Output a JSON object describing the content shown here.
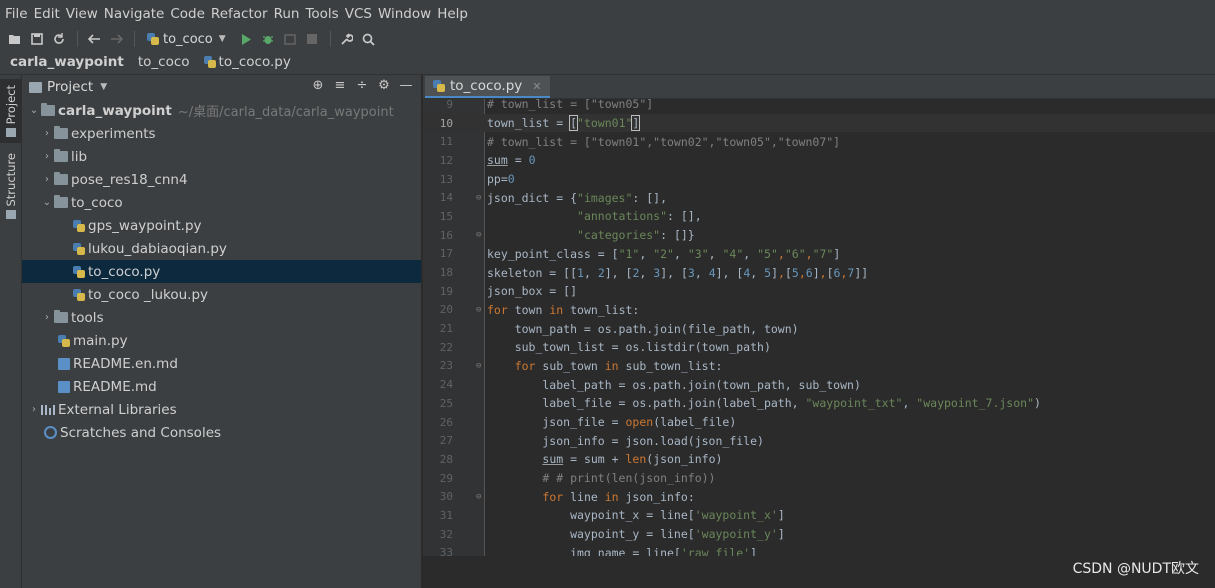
{
  "menu": [
    "File",
    "Edit",
    "View",
    "Navigate",
    "Code",
    "Refactor",
    "Run",
    "Tools",
    "VCS",
    "Window",
    "Help"
  ],
  "toolbar": {
    "run_config": "to_coco"
  },
  "breadcrumb": [
    "carla_waypoint",
    "to_coco",
    "to_coco.py"
  ],
  "strip": {
    "project_tab": "Project",
    "structure_tab": "Structure"
  },
  "project": {
    "title": "Project",
    "root_name": "carla_waypoint",
    "root_path": "~/桌面/carla_data/carla_waypoint",
    "folders": {
      "experiments": "experiments",
      "lib": "lib",
      "pose": "pose_res18_cnn4",
      "to_coco": "to_coco",
      "tools": "tools"
    },
    "files": {
      "gps": "gps_waypoint.py",
      "lukou": "lukou_dabiaoqian.py",
      "to_coco_py": "to_coco.py",
      "to_coco_lukou": "to_coco _lukou.py",
      "main": "main.py",
      "readme_en": "README.en.md",
      "readme": "README.md"
    },
    "external": "External Libraries",
    "scratches": "Scratches and Consoles"
  },
  "editor": {
    "tab_label": "to_coco.py",
    "line_numbers": [
      "9",
      "10",
      "11",
      "12",
      "13",
      "14",
      "15",
      "16",
      "17",
      "18",
      "19",
      "20",
      "21",
      "22",
      "23",
      "24",
      "25",
      "26",
      "27",
      "28",
      "29",
      "30",
      "31",
      "32",
      "33"
    ]
  },
  "watermark": "CSDN @NUDT欧文"
}
